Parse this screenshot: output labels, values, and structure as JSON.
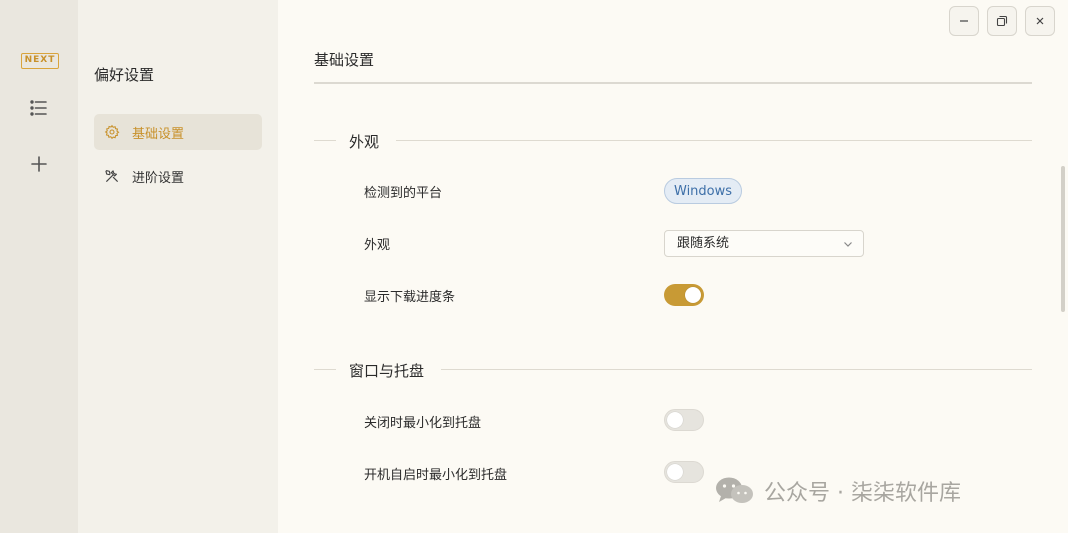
{
  "rail": {
    "logo_text": "NEXT",
    "icons": [
      "list-icon",
      "plus-icon"
    ]
  },
  "sidebar": {
    "title": "偏好设置",
    "items": [
      {
        "label": "基础设置",
        "icon": "gear-icon",
        "active": true
      },
      {
        "label": "进阶设置",
        "icon": "tools-icon",
        "active": false
      }
    ]
  },
  "window_controls": [
    "minimize-icon",
    "restore-icon",
    "close-icon"
  ],
  "main": {
    "title": "基础设置",
    "sections": [
      {
        "title": "外观",
        "rows": [
          {
            "label": "检测到的平台",
            "value": "Windows"
          },
          {
            "label": "外观",
            "value": "跟随系统"
          },
          {
            "label": "显示下载进度条",
            "enabled": true
          }
        ]
      },
      {
        "title": "窗口与托盘",
        "rows": [
          {
            "label": "关闭时最小化到托盘",
            "enabled": false
          },
          {
            "label": "开机自启时最小化到托盘",
            "enabled": false
          }
        ]
      }
    ]
  },
  "watermark": {
    "text": "公众号 · 柒柒软件库"
  },
  "colors": {
    "accent": "#c89a35",
    "badge_text": "#3d6fa8",
    "background": "#fcfaf4"
  }
}
